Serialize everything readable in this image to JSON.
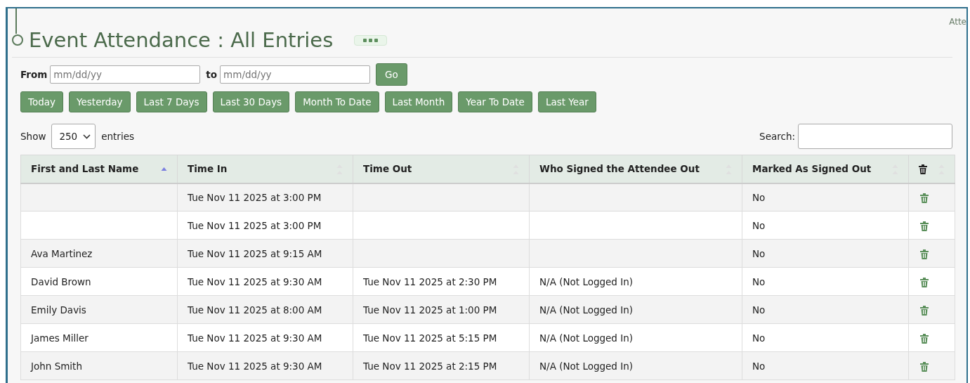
{
  "corner_text": "Atte",
  "title": "Event Attendance : All Entries",
  "date_filter": {
    "from_label": "From",
    "from_placeholder": "mm/dd/yy",
    "to_label": "to",
    "to_placeholder": "mm/dd/yy",
    "go": "Go"
  },
  "range_buttons": [
    "Today",
    "Yesterday",
    "Last 7 Days",
    "Last 30 Days",
    "Month To Date",
    "Last Month",
    "Year To Date",
    "Last Year"
  ],
  "length": {
    "before": "Show",
    "value": "250",
    "after": "entries"
  },
  "search": {
    "label": "Search:"
  },
  "table": {
    "columns": [
      {
        "label": "First and Last Name",
        "sorted": true
      },
      {
        "label": "Time In",
        "sorted": false
      },
      {
        "label": "Time Out",
        "sorted": false
      },
      {
        "label": "Who Signed the Attendee Out",
        "sorted": false
      },
      {
        "label": "Marked As Signed Out",
        "sorted": false
      },
      {
        "kind": "trash",
        "sorted": false
      }
    ],
    "rows": [
      {
        "name": "",
        "time_in": "Tue Nov 11 2025 at 3:00 PM",
        "time_out": "",
        "signed_out_by": "",
        "marked": "No"
      },
      {
        "name": "",
        "time_in": "Tue Nov 11 2025 at 3:00 PM",
        "time_out": "",
        "signed_out_by": "",
        "marked": "No"
      },
      {
        "name": "Ava Martinez",
        "time_in": "Tue Nov 11 2025 at 9:15 AM",
        "time_out": "",
        "signed_out_by": "",
        "marked": "No"
      },
      {
        "name": "David Brown",
        "time_in": "Tue Nov 11 2025 at 9:30 AM",
        "time_out": "Tue Nov 11 2025 at 2:30 PM",
        "signed_out_by": "N/A (Not Logged In)",
        "marked": "No"
      },
      {
        "name": "Emily Davis",
        "time_in": "Tue Nov 11 2025 at 8:00 AM",
        "time_out": "Tue Nov 11 2025 at 1:00 PM",
        "signed_out_by": "N/A (Not Logged In)",
        "marked": "No"
      },
      {
        "name": "James Miller",
        "time_in": "Tue Nov 11 2025 at 9:30 AM",
        "time_out": "Tue Nov 11 2025 at 5:15 PM",
        "signed_out_by": "N/A (Not Logged In)",
        "marked": "No"
      },
      {
        "name": "John Smith",
        "time_in": "Tue Nov 11 2025 at 9:30 AM",
        "time_out": "Tue Nov 11 2025 at 2:15 PM",
        "signed_out_by": "N/A (Not Logged In)",
        "marked": "No"
      }
    ]
  }
}
